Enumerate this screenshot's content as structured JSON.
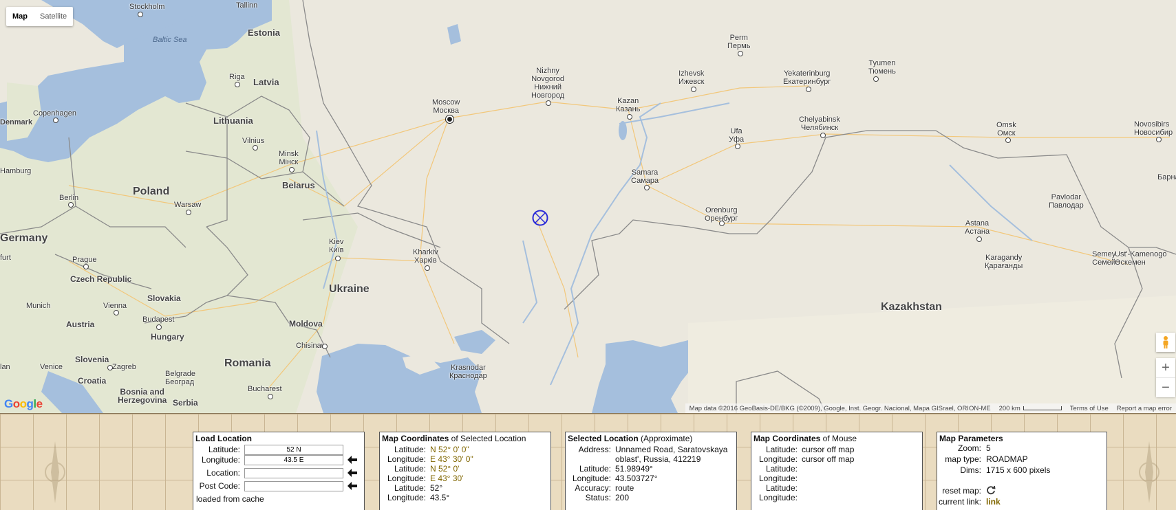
{
  "map": {
    "type_buttons": {
      "map": "Map",
      "satellite": "Satellite"
    },
    "labels": {
      "stockholm": "Stockholm",
      "tallinn": "Tallinn",
      "estonia": "Estonia",
      "baltic_sea": "Baltic Sea",
      "riga": "Riga",
      "latvia": "Latvia",
      "copenhagen": "Copenhagen",
      "denmark": "Denmark",
      "lithuania": "Lithuania",
      "vilnius": "Vilnius",
      "minsk": "Minsk",
      "minsk_cy": "Мінск",
      "hamburg": "Hamburg",
      "belarus": "Belarus",
      "berlin": "Berlin",
      "poland": "Poland",
      "warsaw": "Warsaw",
      "germany": "Germany",
      "furt": "furt",
      "prague": "Prague",
      "kiev": "Kiev",
      "kiev_cy": "Київ",
      "czech": "Czech Republic",
      "slovakia": "Slovakia",
      "munich": "Munich",
      "vienna": "Vienna",
      "austria": "Austria",
      "budapest": "Budapest",
      "hungary": "Hungary",
      "moldova": "Moldova",
      "chisinau": "Chisinau",
      "ukraine": "Ukraine",
      "kharkiv": "Kharkiv",
      "kharkiv_cy": "Харків",
      "romania": "Romania",
      "lan": "lan",
      "venice": "Venice",
      "slovenia": "Slovenia",
      "zagreb": "Zagreb",
      "croatia": "Croatia",
      "belgrade": "Belgrade",
      "belgrade_cy": "Београд",
      "bosnia": "Bosnia and",
      "herzegovina": "Herzegovina",
      "serbia": "Serbia",
      "bucharest": "Bucharest",
      "krasnodar": "Krasnodar",
      "krasnodar_cy": "Краснодар",
      "moscow": "Moscow",
      "moscow_cy": "Москва",
      "nizhny1": "Nizhny",
      "nizhny2": "Novgorod",
      "nizhny_cy1": "Нижний",
      "nizhny_cy2": "Новгород",
      "kazan": "Kazan",
      "kazan_cy": "Казань",
      "perm": "Perm",
      "perm_cy": "Пермь",
      "izhevsk": "Izhevsk",
      "izhevsk_cy": "Ижевск",
      "yekaterinburg": "Yekaterinburg",
      "yekaterinburg_cy": "Екатеринбург",
      "tyumen": "Tyumen",
      "tyumen_cy": "Тюмень",
      "samara": "Samara",
      "samara_cy": "Самара",
      "ufa": "Ufa",
      "ufa_cy": "Уфа",
      "chelyabinsk": "Chelyabinsk",
      "chelyabinsk_cy": "Челябинск",
      "omsk": "Omsk",
      "omsk_cy": "Омск",
      "novosibirsk": "Novosibirs",
      "novosibirsk_cy": "Новосибир",
      "barna": "Барна",
      "orenburg": "Orenburg",
      "orenburg_cy": "Оренбург",
      "pavlodar": "Pavlodar",
      "pavlodar_cy": "Павлодар",
      "astana": "Astana",
      "astana_cy": "Астана",
      "karagandy": "Karagandy",
      "karagandy_cy": "Қарағанды",
      "semey": "Semey",
      "semey_cy": "Семей",
      "ustk": "Ust'-Kamenogo",
      "ustk_cy": "Өскемен",
      "kazakhstan": "Kazakhstan"
    },
    "attribution": {
      "data": "Map data ©2016 GeoBasis-DE/BKG (©2009), Google, Inst. Geogr. Nacional, Mapa GISrael, ORION-ME",
      "scale": "200 km",
      "terms": "Terms of Use",
      "report": "Report a map error"
    },
    "logo": "Google",
    "colors": {
      "land": "#ebe8de",
      "water": "#a5bfdd",
      "border": "#8a8a8a",
      "road": "#f2c77a",
      "marker": "#2a2ad8"
    }
  },
  "load_location": {
    "title": "Load Location",
    "latitude_label": "Latitude:",
    "latitude_value": "52 N",
    "longitude_label": "Longitude:",
    "longitude_value": "43.5 E",
    "location_label": "Location:",
    "location_value": "",
    "postcode_label": "Post Code:",
    "postcode_value": "",
    "status": "loaded from cache"
  },
  "map_coords_selected": {
    "title_bold": "Map Coordinates",
    "title_rest": " of Selected Location",
    "rows": [
      {
        "label": "Latitude:",
        "value": "N 52° 0' 0\""
      },
      {
        "label": "Longitude:",
        "value": "E 43° 30' 0\""
      },
      {
        "label": "Latitude:",
        "value": "N 52° 0'"
      },
      {
        "label": "Longitude:",
        "value": "E 43° 30'"
      },
      {
        "label": "Latitude:",
        "value": "52°"
      },
      {
        "label": "Longitude:",
        "value": "43.5°"
      }
    ]
  },
  "selected_location": {
    "title_bold": "Selected Location",
    "title_rest": " (Approximate)",
    "address_label": "Address:",
    "address_line1": "Unnamed Road, Saratovskaya",
    "address_line2": "oblast', Russia, 412219",
    "latitude_label": "Latitude:",
    "latitude_value": "51.98949°",
    "longitude_label": "Longitude:",
    "longitude_value": "43.503727°",
    "accuracy_label": "Accuracy:",
    "accuracy_value": "route",
    "status_label": "Status:",
    "status_value": "200"
  },
  "map_coords_mouse": {
    "title_bold": "Map Coordinates",
    "title_rest": " of Mouse",
    "rows": [
      {
        "label": "Latitude:",
        "value": "cursor off map"
      },
      {
        "label": "Longitude:",
        "value": "cursor off map"
      },
      {
        "label": "Latitude:",
        "value": ""
      },
      {
        "label": "Longitude:",
        "value": ""
      },
      {
        "label": "Latitude:",
        "value": ""
      },
      {
        "label": "Longitude:",
        "value": ""
      }
    ]
  },
  "map_parameters": {
    "title": "Map Parameters",
    "zoom_label": "Zoom:",
    "zoom_value": "5",
    "maptype_label": "map type:",
    "maptype_value": "ROADMAP",
    "dims_label": "Dims:",
    "dims_value": "1715 x 600 pixels",
    "reset_label": "reset map:",
    "link_label": "current link:",
    "link_value": "link"
  }
}
